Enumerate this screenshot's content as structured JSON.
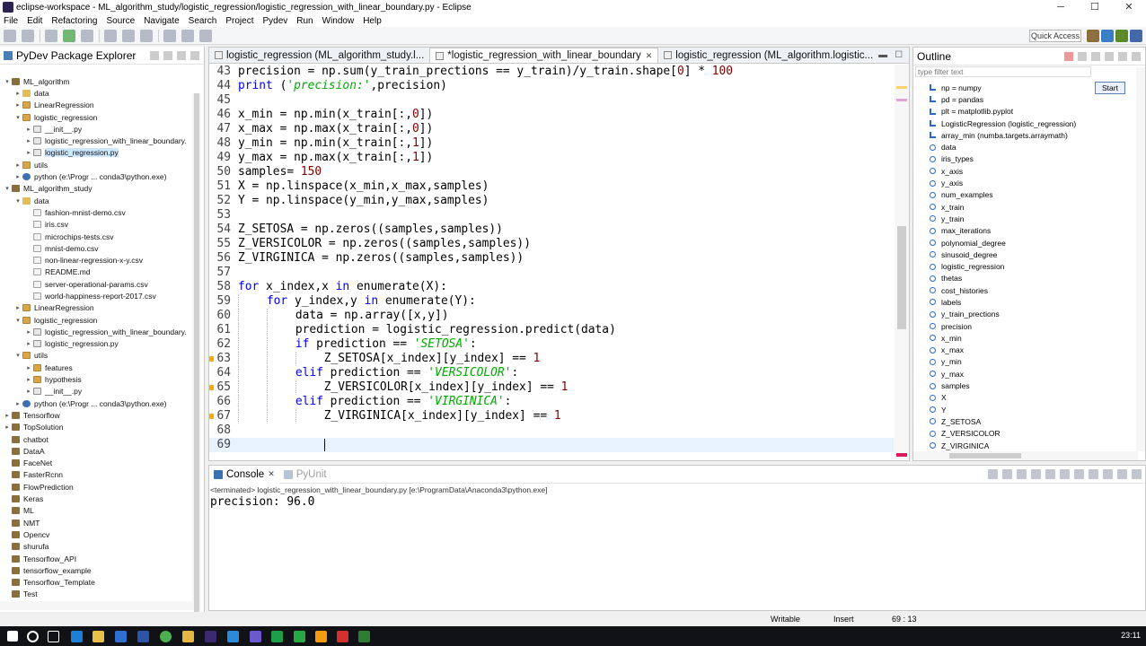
{
  "window": {
    "title": "eclipse-workspace - ML_algorithm_study/logistic_regression/logistic_regression_with_linear_boundary.py - Eclipse",
    "minimize": "─",
    "maximize": "☐",
    "close": "✕"
  },
  "menu": [
    "File",
    "Edit",
    "Refactoring",
    "Source",
    "Navigate",
    "Search",
    "Project",
    "Pydev",
    "Run",
    "Window",
    "Help"
  ],
  "toolbar": {
    "quick_access": "Quick Access"
  },
  "explorer": {
    "title": "PyDev Package Explorer",
    "tree": [
      {
        "indent": 0,
        "twisty": "▾",
        "icon": "proj",
        "label": "ML_algorithm"
      },
      {
        "indent": 1,
        "twisty": "▸",
        "icon": "folder",
        "label": "data"
      },
      {
        "indent": 1,
        "twisty": "▸",
        "icon": "pkg",
        "label": "LinearRegression"
      },
      {
        "indent": 1,
        "twisty": "▾",
        "icon": "pkg",
        "label": "logistic_regression"
      },
      {
        "indent": 2,
        "twisty": "▸",
        "icon": "py",
        "label": "__init__.py"
      },
      {
        "indent": 2,
        "twisty": "▸",
        "icon": "py",
        "label": "logistic_regression_with_linear_boundary."
      },
      {
        "indent": 2,
        "twisty": "▸",
        "icon": "py",
        "label": "logistic_regression.py",
        "selected": true
      },
      {
        "indent": 1,
        "twisty": "▸",
        "icon": "pkg",
        "label": "utils"
      },
      {
        "indent": 1,
        "twisty": "▸",
        "icon": "interp",
        "label": "python  (e:\\Progr ... conda3\\python.exe)"
      },
      {
        "indent": 0,
        "twisty": "▾",
        "icon": "proj",
        "label": "ML_algorithm_study"
      },
      {
        "indent": 1,
        "twisty": "▾",
        "icon": "folder",
        "label": "data"
      },
      {
        "indent": 2,
        "twisty": "",
        "icon": "csv",
        "label": "fashion-mnist-demo.csv"
      },
      {
        "indent": 2,
        "twisty": "",
        "icon": "csv",
        "label": "iris.csv"
      },
      {
        "indent": 2,
        "twisty": "",
        "icon": "csv",
        "label": "microchips-tests.csv"
      },
      {
        "indent": 2,
        "twisty": "",
        "icon": "csv",
        "label": "mnist-demo.csv"
      },
      {
        "indent": 2,
        "twisty": "",
        "icon": "csv",
        "label": "non-linear-regression-x-y.csv"
      },
      {
        "indent": 2,
        "twisty": "",
        "icon": "csv",
        "label": "README.md"
      },
      {
        "indent": 2,
        "twisty": "",
        "icon": "csv",
        "label": "server-operational-params.csv"
      },
      {
        "indent": 2,
        "twisty": "",
        "icon": "csv",
        "label": "world-happiness-report-2017.csv"
      },
      {
        "indent": 1,
        "twisty": "▸",
        "icon": "pkg",
        "label": "LinearRegression"
      },
      {
        "indent": 1,
        "twisty": "▾",
        "icon": "pkg",
        "label": "logistic_regression"
      },
      {
        "indent": 2,
        "twisty": "▸",
        "icon": "py",
        "label": "logistic_regression_with_linear_boundary."
      },
      {
        "indent": 2,
        "twisty": "▸",
        "icon": "py",
        "label": "logistic_regression.py"
      },
      {
        "indent": 1,
        "twisty": "▾",
        "icon": "pkg",
        "label": "utils"
      },
      {
        "indent": 2,
        "twisty": "▸",
        "icon": "pkg",
        "label": "features"
      },
      {
        "indent": 2,
        "twisty": "▸",
        "icon": "pkg",
        "label": "hypothesis"
      },
      {
        "indent": 2,
        "twisty": "▸",
        "icon": "py",
        "label": "__init__.py"
      },
      {
        "indent": 1,
        "twisty": "▸",
        "icon": "interp",
        "label": "python  (e:\\Progr ... conda3\\python.exe)"
      },
      {
        "indent": 0,
        "twisty": "▸",
        "icon": "proj",
        "label": "Tensorflow"
      },
      {
        "indent": 0,
        "twisty": "▸",
        "icon": "proj",
        "label": "TopSolution"
      },
      {
        "indent": 0,
        "twisty": "",
        "icon": "proj",
        "label": "chatbot"
      },
      {
        "indent": 0,
        "twisty": "",
        "icon": "proj",
        "label": "DataA"
      },
      {
        "indent": 0,
        "twisty": "",
        "icon": "proj",
        "label": "FaceNet"
      },
      {
        "indent": 0,
        "twisty": "",
        "icon": "proj",
        "label": "FasterRcnn"
      },
      {
        "indent": 0,
        "twisty": "",
        "icon": "proj",
        "label": "FlowPrediction"
      },
      {
        "indent": 0,
        "twisty": "",
        "icon": "proj",
        "label": "Keras"
      },
      {
        "indent": 0,
        "twisty": "",
        "icon": "proj",
        "label": "ML"
      },
      {
        "indent": 0,
        "twisty": "",
        "icon": "proj",
        "label": "NMT"
      },
      {
        "indent": 0,
        "twisty": "",
        "icon": "proj",
        "label": "Opencv"
      },
      {
        "indent": 0,
        "twisty": "",
        "icon": "proj",
        "label": "shurufa"
      },
      {
        "indent": 0,
        "twisty": "",
        "icon": "proj",
        "label": "Tensorflow_API"
      },
      {
        "indent": 0,
        "twisty": "",
        "icon": "proj",
        "label": "tensorflow_example"
      },
      {
        "indent": 0,
        "twisty": "",
        "icon": "proj",
        "label": "Tensorflow_Template"
      },
      {
        "indent": 0,
        "twisty": "",
        "icon": "proj",
        "label": "Test"
      }
    ]
  },
  "editor": {
    "tabs": [
      {
        "label": "logistic_regression (ML_algorithm_study.l...",
        "active": false,
        "closable": false
      },
      {
        "label": "*logistic_regression_with_linear_boundary",
        "active": true,
        "closable": true
      },
      {
        "label": "logistic_regression (ML_algorithm.logistic...",
        "active": false,
        "closable": false
      }
    ],
    "lines": [
      {
        "n": "43",
        "indent": 0,
        "tokens": [
          [
            "t",
            "precision = np.sum(y_train_prections == y_train)/y_train.shape["
          ],
          [
            "n",
            "0"
          ],
          [
            "t",
            "] * "
          ],
          [
            "n",
            "100"
          ]
        ]
      },
      {
        "n": "44",
        "indent": 0,
        "tokens": [
          [
            "k",
            "print"
          ],
          [
            "t",
            " ("
          ],
          [
            "s",
            "'precision:'"
          ],
          [
            "t",
            ",precision)"
          ]
        ]
      },
      {
        "n": "45",
        "indent": 0,
        "tokens": []
      },
      {
        "n": "46",
        "indent": 0,
        "tokens": [
          [
            "t",
            "x_min = np.min(x_train[:,"
          ],
          [
            "n",
            "0"
          ],
          [
            "t",
            "])"
          ]
        ]
      },
      {
        "n": "47",
        "indent": 0,
        "tokens": [
          [
            "t",
            "x_max = np.max(x_train[:,"
          ],
          [
            "n",
            "0"
          ],
          [
            "t",
            "])"
          ]
        ]
      },
      {
        "n": "48",
        "indent": 0,
        "tokens": [
          [
            "t",
            "y_min = np.min(x_train[:,"
          ],
          [
            "n",
            "1"
          ],
          [
            "t",
            "])"
          ]
        ]
      },
      {
        "n": "49",
        "indent": 0,
        "tokens": [
          [
            "t",
            "y_max = np.max(x_train[:,"
          ],
          [
            "n",
            "1"
          ],
          [
            "t",
            "])"
          ]
        ]
      },
      {
        "n": "50",
        "indent": 0,
        "tokens": [
          [
            "t",
            "samples= "
          ],
          [
            "n",
            "150"
          ]
        ]
      },
      {
        "n": "51",
        "indent": 0,
        "tokens": [
          [
            "t",
            "X = np.linspace(x_min,x_max,samples)"
          ]
        ]
      },
      {
        "n": "52",
        "indent": 0,
        "tokens": [
          [
            "t",
            "Y = np.linspace(y_min,y_max,samples)"
          ]
        ]
      },
      {
        "n": "53",
        "indent": 0,
        "tokens": []
      },
      {
        "n": "54",
        "indent": 0,
        "tokens": [
          [
            "t",
            "Z_SETOSA = np.zeros((samples,samples))"
          ]
        ]
      },
      {
        "n": "55",
        "indent": 0,
        "tokens": [
          [
            "t",
            "Z_VERSICOLOR = np.zeros((samples,samples))"
          ]
        ]
      },
      {
        "n": "56",
        "indent": 0,
        "tokens": [
          [
            "t",
            "Z_VIRGINICA = np.zeros((samples,samples))"
          ]
        ]
      },
      {
        "n": "57",
        "indent": 0,
        "tokens": []
      },
      {
        "n": "58",
        "indent": 0,
        "tokens": [
          [
            "k",
            "for"
          ],
          [
            "t",
            " x_index,x "
          ],
          [
            "k",
            "in"
          ],
          [
            "t",
            " enumerate(X):"
          ]
        ]
      },
      {
        "n": "59",
        "indent": 1,
        "tokens": [
          [
            "k",
            "for"
          ],
          [
            "t",
            " y_index,y "
          ],
          [
            "k",
            "in"
          ],
          [
            "t",
            " enumerate(Y):"
          ]
        ]
      },
      {
        "n": "60",
        "indent": 2,
        "tokens": [
          [
            "t",
            "data = np.array([x,y])"
          ]
        ]
      },
      {
        "n": "61",
        "indent": 2,
        "tokens": [
          [
            "t",
            "prediction = logistic_regression.predict(data)"
          ]
        ]
      },
      {
        "n": "62",
        "indent": 2,
        "tokens": [
          [
            "k",
            "if"
          ],
          [
            "t",
            " prediction == "
          ],
          [
            "s",
            "'SETOSA'"
          ],
          [
            "t",
            ":"
          ]
        ]
      },
      {
        "n": "63",
        "indent": 3,
        "warn": true,
        "tokens": [
          [
            "t",
            "Z_SETOSA[x_index][y_index] == "
          ],
          [
            "n",
            "1"
          ]
        ]
      },
      {
        "n": "64",
        "indent": 2,
        "tokens": [
          [
            "k",
            "elif"
          ],
          [
            "t",
            " prediction == "
          ],
          [
            "s",
            "'VERSICOLOR'"
          ],
          [
            "t",
            ":"
          ]
        ]
      },
      {
        "n": "65",
        "indent": 3,
        "warn": true,
        "tokens": [
          [
            "t",
            "Z_VERSICOLOR[x_index][y_index] == "
          ],
          [
            "n",
            "1"
          ]
        ]
      },
      {
        "n": "66",
        "indent": 2,
        "tokens": [
          [
            "k",
            "elif"
          ],
          [
            "t",
            " prediction == "
          ],
          [
            "s",
            "'VIRGINICA'"
          ],
          [
            "t",
            ":"
          ]
        ]
      },
      {
        "n": "67",
        "indent": 3,
        "warn": true,
        "tokens": [
          [
            "t",
            "Z_VIRGINICA[x_index][y_index] == "
          ],
          [
            "n",
            "1"
          ]
        ]
      },
      {
        "n": "68",
        "indent": 0,
        "tokens": []
      },
      {
        "n": "69",
        "indent": 0,
        "current": true,
        "tokens": []
      }
    ]
  },
  "outline": {
    "title": "Outline",
    "filter_placeholder": "type filter text",
    "start_button": "Start",
    "items": [
      {
        "kind": "import",
        "label": "np = numpy"
      },
      {
        "kind": "import",
        "label": "pd = pandas"
      },
      {
        "kind": "import",
        "label": "plt = matplotlib.pyplot"
      },
      {
        "kind": "import",
        "label": "LogisticRegression (logistic_regression)"
      },
      {
        "kind": "import",
        "label": "array_min (numba.targets.arraymath)"
      },
      {
        "kind": "var",
        "label": "data"
      },
      {
        "kind": "var",
        "label": "iris_types"
      },
      {
        "kind": "var",
        "label": "x_axis"
      },
      {
        "kind": "var",
        "label": "y_axis"
      },
      {
        "kind": "var",
        "label": "num_examples"
      },
      {
        "kind": "var",
        "label": "x_train"
      },
      {
        "kind": "var",
        "label": "y_train"
      },
      {
        "kind": "var",
        "label": "max_iterations"
      },
      {
        "kind": "var",
        "label": "polynomial_degree"
      },
      {
        "kind": "var",
        "label": "sinusoid_degree"
      },
      {
        "kind": "var",
        "label": "logistic_regression"
      },
      {
        "kind": "var",
        "label": "thetas"
      },
      {
        "kind": "var",
        "label": "cost_histories"
      },
      {
        "kind": "var",
        "label": "labels"
      },
      {
        "kind": "var",
        "label": "y_train_prections"
      },
      {
        "kind": "var",
        "label": "precision"
      },
      {
        "kind": "var",
        "label": "x_min"
      },
      {
        "kind": "var",
        "label": "x_max"
      },
      {
        "kind": "var",
        "label": "y_min"
      },
      {
        "kind": "var",
        "label": "y_max"
      },
      {
        "kind": "var",
        "label": "samples"
      },
      {
        "kind": "var",
        "label": "X"
      },
      {
        "kind": "var",
        "label": "Y"
      },
      {
        "kind": "var",
        "label": "Z_SETOSA"
      },
      {
        "kind": "var",
        "label": "Z_VERSICOLOR"
      },
      {
        "kind": "var",
        "label": "Z_VIRGINICA"
      }
    ]
  },
  "console": {
    "tabs": [
      "Console",
      "PyUnit"
    ],
    "terminated": "<terminated> logistic_regression_with_linear_boundary.py [e:\\ProgramData\\Anaconda3\\python.exe]",
    "output": "precision: 96.0"
  },
  "status": {
    "writable": "Writable",
    "insert": "Insert",
    "position": "69 : 13"
  },
  "taskbar": {
    "time": "23:11"
  }
}
